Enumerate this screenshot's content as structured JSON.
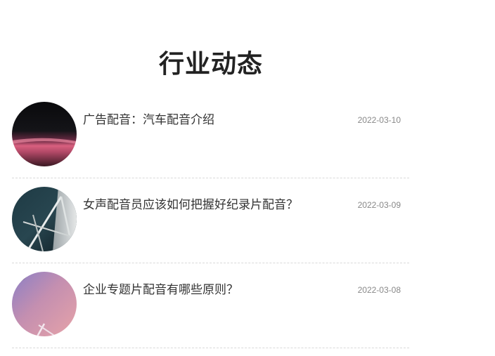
{
  "section": {
    "title": "行业动态"
  },
  "news": [
    {
      "title": "广告配音：汽车配音介绍",
      "date": "2022-03-10",
      "thumbnail_icon": "car-photo-icon"
    },
    {
      "title": "女声配音员应该如何把握好纪录片配音？",
      "date": "2022-03-09",
      "thumbnail_icon": "architecture-photo-icon"
    },
    {
      "title": "企业专题片配音有哪些原则？",
      "date": "2022-03-08",
      "thumbnail_icon": "pastel-abstract-photo-icon"
    }
  ]
}
